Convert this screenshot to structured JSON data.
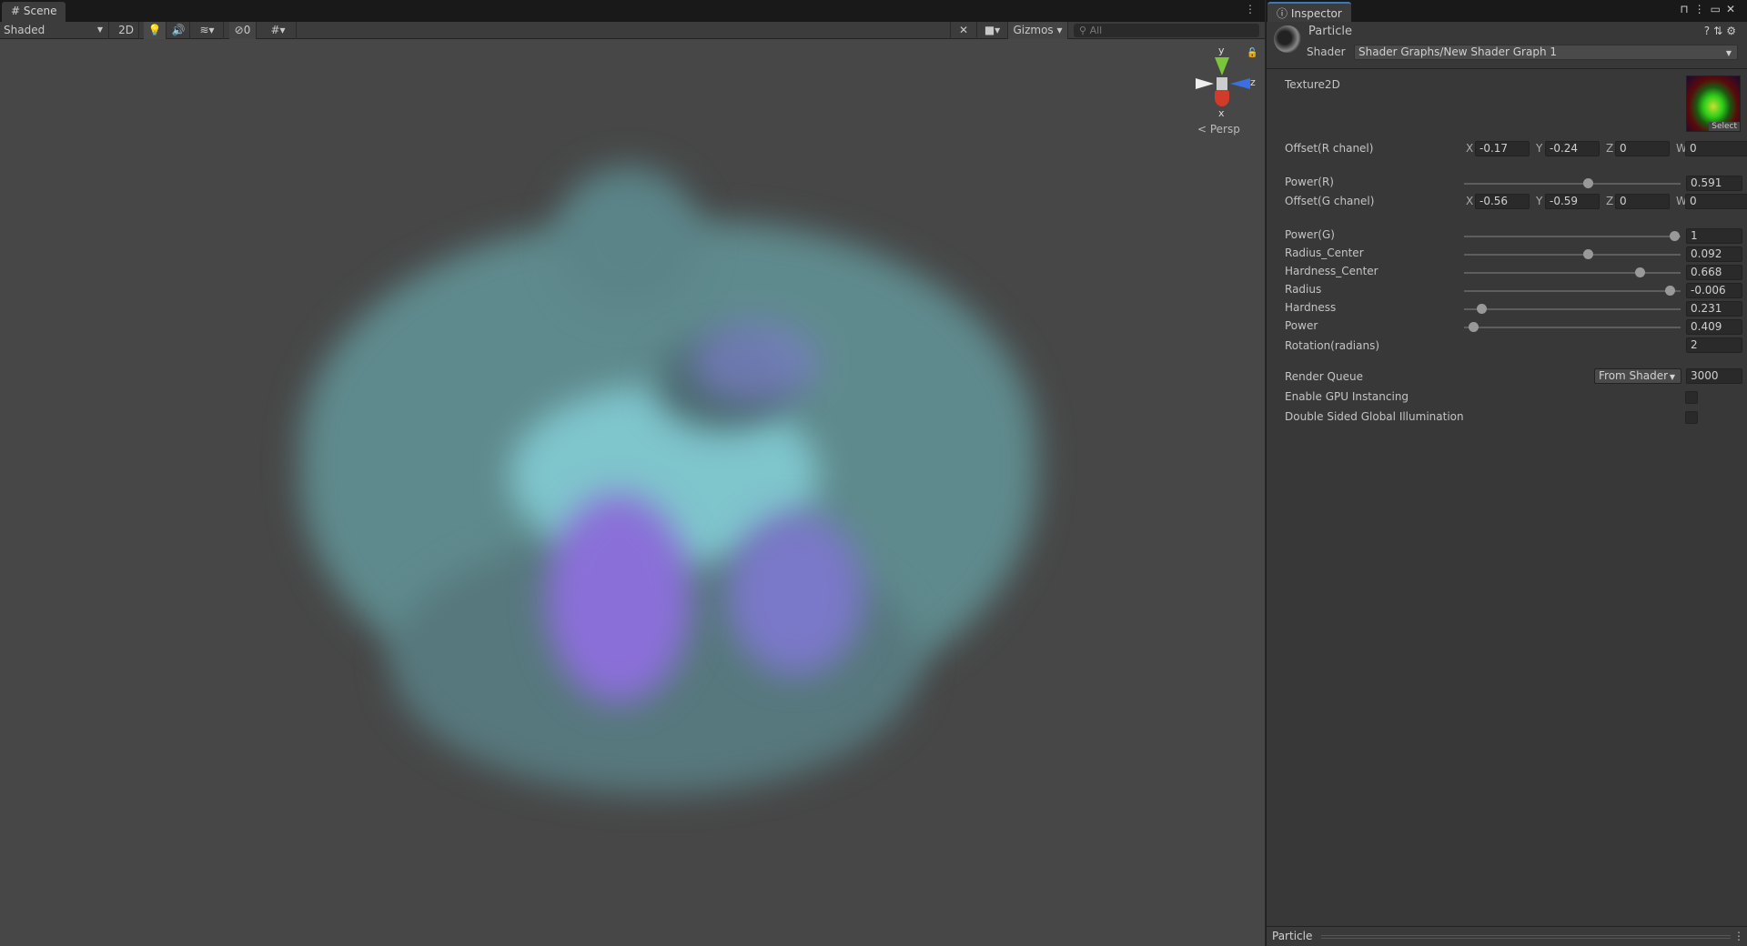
{
  "scene": {
    "tab": "Scene",
    "shading": "Shaded",
    "mode_2d": "2D",
    "hidden_count": "0",
    "gizmos": "Gizmos",
    "search_placeholder": "All",
    "persp": "< Persp",
    "axes": {
      "y": "y",
      "z": "z",
      "x": "x"
    }
  },
  "inspector": {
    "tab": "Inspector",
    "material": "Particle",
    "shader_label": "Shader",
    "shader": "Shader Graphs/New Shader Graph 1",
    "texture_label": "Texture2D",
    "select": "Select",
    "offset_r": {
      "label": "Offset(R chanel)",
      "x": "-0.17",
      "y": "-0.24",
      "z": "0",
      "w": "0"
    },
    "offset_g": {
      "label": "Offset(G chanel)",
      "x": "-0.56",
      "y": "-0.59",
      "z": "0",
      "w": "0"
    },
    "sliders": [
      {
        "label": "Power(R)",
        "value": "0.591",
        "position": 0.57
      },
      {
        "label": "Power(G)",
        "value": "1",
        "position": 0.97
      },
      {
        "label": "Radius_Center",
        "value": "0.092",
        "position": 0.57
      },
      {
        "label": "Hardness_Center",
        "value": "0.668",
        "position": 0.81
      },
      {
        "label": "Radius",
        "value": "-0.006",
        "position": 0.95
      },
      {
        "label": "Hardness",
        "value": "0.231",
        "position": 0.08
      },
      {
        "label": "Power",
        "value": "0.409",
        "position": 0.04
      }
    ],
    "rotation": {
      "label": "Rotation(radians)",
      "value": "2"
    },
    "render_queue": {
      "label": "Render Queue",
      "mode": "From Shader",
      "value": "3000"
    },
    "gpu_instancing": {
      "label": "Enable GPU Instancing",
      "checked": false
    },
    "double_sided": {
      "label": "Double Sided Global Illumination",
      "checked": false
    },
    "footer": "Particle"
  },
  "colors": {
    "accent": "#3a79bb",
    "panel": "#383838",
    "scene_bg": "#474747"
  }
}
